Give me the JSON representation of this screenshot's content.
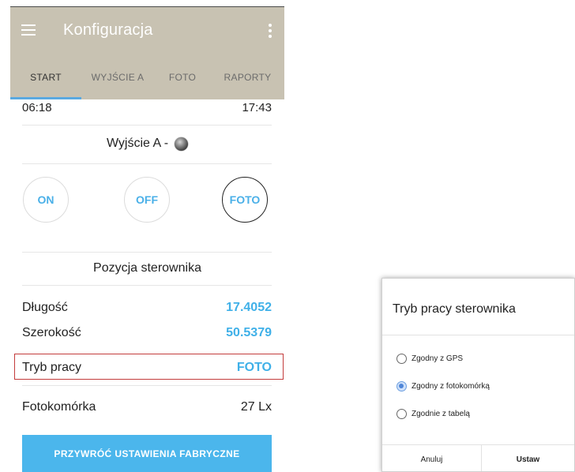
{
  "appbar": {
    "title": "Konfiguracja"
  },
  "tabs": [
    {
      "label": "START",
      "active": true
    },
    {
      "label": "WYJŚCIE A",
      "active": false
    },
    {
      "label": "FOTO",
      "active": false
    },
    {
      "label": "RAPORTY",
      "active": false
    }
  ],
  "times": {
    "left": "06:18",
    "right": "17:43"
  },
  "output": {
    "label": "Wyjście A -"
  },
  "mode_buttons": {
    "on": "ON",
    "off": "OFF",
    "foto": "FOTO"
  },
  "position": {
    "title": "Pozycja sterownika",
    "longitude_label": "Długość",
    "longitude_value": "17.4052",
    "latitude_label": "Szerokość",
    "latitude_value": "50.5379"
  },
  "mode_row": {
    "label": "Tryb pracy",
    "value": "FOTO"
  },
  "photocell": {
    "label": "Fotokomórka",
    "value": "27 Lx"
  },
  "reset_button": "PRZYWRÓĆ USTAWIENIA FABRYCZNE",
  "dialog": {
    "title": "Tryb pracy sterownika",
    "options": [
      {
        "label": "Zgodny z GPS",
        "checked": false
      },
      {
        "label": "Zgodny z fotokomórką",
        "checked": true
      },
      {
        "label": "Zgodnie z tabelą",
        "checked": false
      }
    ],
    "cancel": "Anuluj",
    "ok": "Ustaw"
  },
  "colors": {
    "appbar_bg": "#c8c2b2",
    "accent": "#4bb6ec",
    "tab_indicator": "#5aa9e0",
    "highlight_border": "#c33b3b"
  }
}
